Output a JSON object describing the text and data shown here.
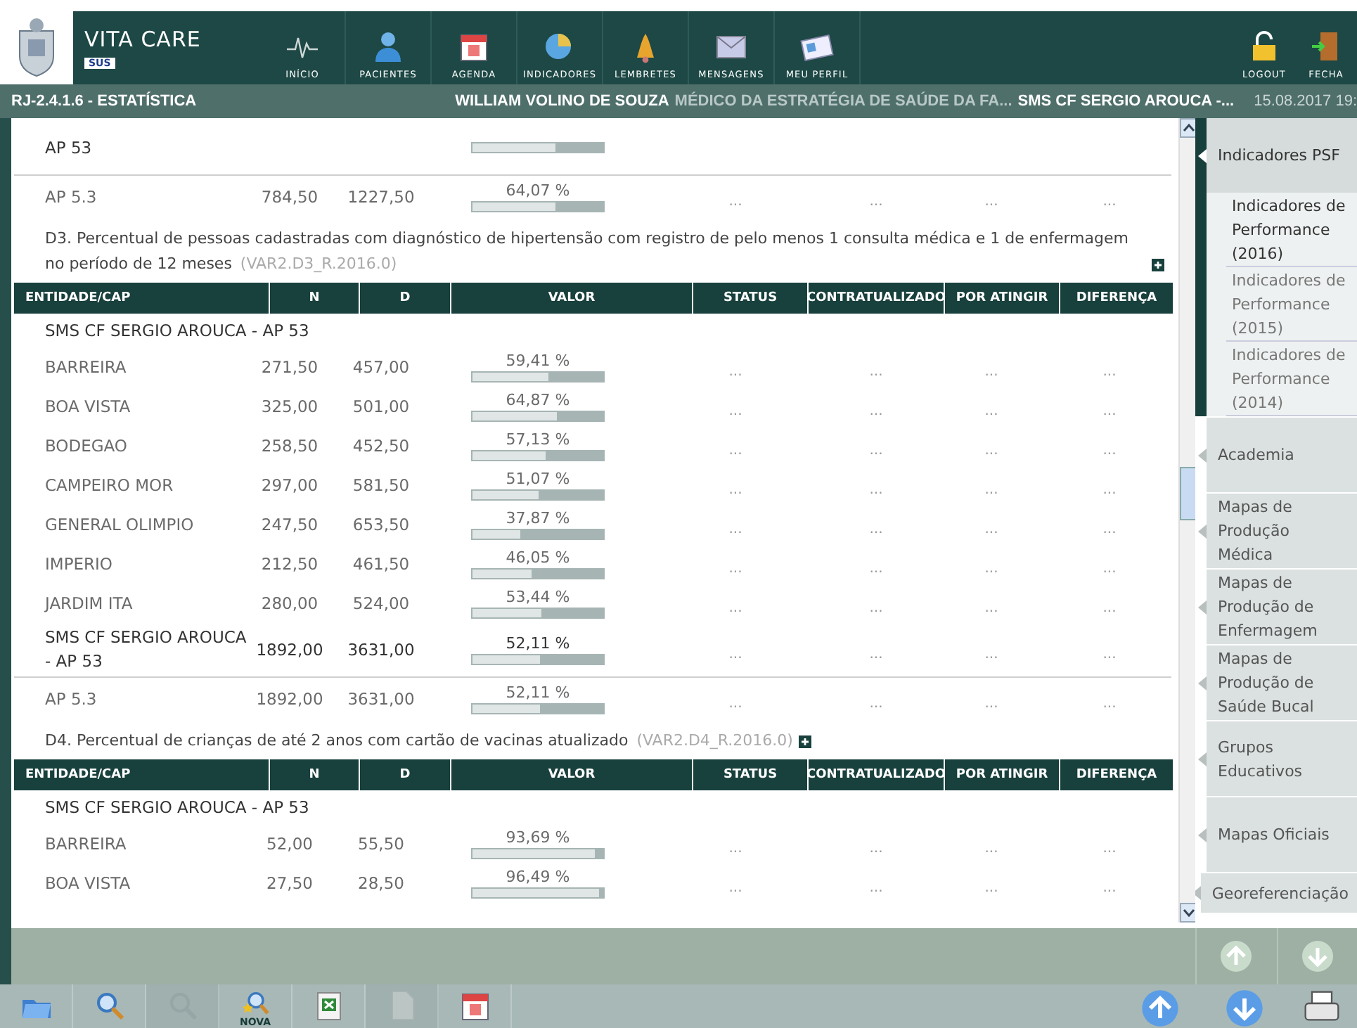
{
  "header": {
    "brand": "VITA CARE",
    "sub": "SUS",
    "nav": [
      {
        "kind": "pulse",
        "label": "INÍCIO"
      },
      {
        "kind": "person",
        "label": "PACIENTES"
      },
      {
        "kind": "calendar",
        "label": "AGENDA"
      },
      {
        "kind": "chart",
        "label": "INDICADORES"
      },
      {
        "kind": "bell",
        "label": "LEMBRETES"
      },
      {
        "kind": "mail",
        "label": "MENSAGENS"
      },
      {
        "kind": "card",
        "label": "MEU PERFIL"
      }
    ],
    "actions": [
      {
        "kind": "lock",
        "label": "LOGOUT"
      },
      {
        "kind": "door",
        "label": "FECHA"
      }
    ]
  },
  "info_bar": {
    "module": "RJ-2.4.1.6 - ESTATÍSTICA",
    "user": "WILLIAM VOLINO DE SOUZA",
    "role": "MÉDICO DA ESTRATÉGIA DE SAÚDE DA FA...",
    "unit": "SMS CF SERGIO AROUCA -...",
    "date": "15.08.2017 19:"
  },
  "sections": [
    {
      "rows": [
        {
          "kind": "total",
          "name": "AP 53",
          "level": 0.64
        },
        {
          "kind": "area",
          "name": "AP 5.3",
          "n": "784,50",
          "d": "1227,50",
          "value": "64,07 %",
          "level": 0.64,
          "status": "...",
          "contract": "...",
          "remaining": "...",
          "difference": "..."
        }
      ]
    },
    {
      "title": "D3. Percentual de pessoas cadastradas com diagnóstico de hipertensão com registro de pelo menos 1 consulta médica e 1 de enfermagem no período de 12 meses",
      "code": "(VAR2.D3_R.2016.0)",
      "columns": [
        "ENTIDADE/CAP",
        "N",
        "D",
        "VALOR",
        "STATUS",
        "CONTRATUALIZADO",
        "POR ATINGIR",
        "DIFERENÇA"
      ],
      "rows": [
        {
          "kind": "group",
          "name": "SMS CF SERGIO AROUCA - AP 53"
        },
        {
          "kind": "unit",
          "name": "BARREIRA",
          "n": "271,50",
          "d": "457,00",
          "value": "59,41 %",
          "level": 0.5941,
          "status": "...",
          "contract": "...",
          "remaining": "...",
          "difference": "..."
        },
        {
          "kind": "unit",
          "name": "BOA VISTA",
          "n": "325,00",
          "d": "501,00",
          "value": "64,87 %",
          "level": 0.6487,
          "status": "...",
          "contract": "...",
          "remaining": "...",
          "difference": "..."
        },
        {
          "kind": "unit",
          "name": "BODEGAO",
          "n": "258,50",
          "d": "452,50",
          "value": "57,13 %",
          "level": 0.5713,
          "status": "...",
          "contract": "...",
          "remaining": "...",
          "difference": "..."
        },
        {
          "kind": "unit",
          "name": "CAMPEIRO MOR",
          "n": "297,00",
          "d": "581,50",
          "value": "51,07 %",
          "level": 0.5107,
          "status": "...",
          "contract": "...",
          "remaining": "...",
          "difference": "..."
        },
        {
          "kind": "unit",
          "name": "GENERAL OLIMPIO",
          "n": "247,50",
          "d": "653,50",
          "value": "37,87 %",
          "level": 0.3787,
          "status": "...",
          "contract": "...",
          "remaining": "...",
          "difference": "..."
        },
        {
          "kind": "unit",
          "name": "IMPERIO",
          "n": "212,50",
          "d": "461,50",
          "value": "46,05 %",
          "level": 0.4605,
          "status": "...",
          "contract": "...",
          "remaining": "...",
          "difference": "..."
        },
        {
          "kind": "unit",
          "name": "JARDIM ITA",
          "n": "280,00",
          "d": "524,00",
          "value": "53,44 %",
          "level": 0.5344,
          "status": "...",
          "contract": "...",
          "remaining": "...",
          "difference": "..."
        },
        {
          "kind": "total",
          "name": "SMS CF SERGIO AROUCA - AP 53",
          "n": "1892,00",
          "d": "3631,00",
          "value": "52,11 %",
          "level": 0.5211,
          "status": "...",
          "contract": "...",
          "remaining": "...",
          "difference": "..."
        },
        {
          "kind": "area",
          "name": "AP 5.3",
          "n": "1892,00",
          "d": "3631,00",
          "value": "52,11 %",
          "level": 0.5211,
          "status": "...",
          "contract": "...",
          "remaining": "...",
          "difference": "..."
        }
      ]
    },
    {
      "title": "D4. Percentual de crianças de até 2 anos com cartão de vacinas atualizado",
      "code": "(VAR2.D4_R.2016.0)",
      "columns": [
        "ENTIDADE/CAP",
        "N",
        "D",
        "VALOR",
        "STATUS",
        "CONTRATUALIZADO",
        "POR ATINGIR",
        "DIFERENÇA"
      ],
      "rows": [
        {
          "kind": "group",
          "name": "SMS CF SERGIO AROUCA - AP 53"
        },
        {
          "kind": "unit",
          "name": "BARREIRA",
          "n": "52,00",
          "d": "55,50",
          "value": "93,69 %",
          "level": 0.9369,
          "status": "...",
          "contract": "...",
          "remaining": "...",
          "difference": "..."
        },
        {
          "kind": "unit",
          "name": "BOA VISTA",
          "n": "27,50",
          "d": "28,50",
          "value": "96,49 %",
          "level": 0.9649,
          "status": "...",
          "contract": "...",
          "remaining": "...",
          "difference": "..."
        }
      ]
    }
  ],
  "sidebar": {
    "items": [
      {
        "label": "Indicadores PSF",
        "expanded": true,
        "children": [
          {
            "label": "Indicadores de Performance (2016)",
            "selected": true
          },
          {
            "label": "Indicadores de Performance (2015)",
            "selected": false
          },
          {
            "label": "Indicadores de Performance (2014)",
            "selected": false
          }
        ]
      },
      {
        "label": "Academia",
        "expanded": false
      },
      {
        "label": "Mapas de Produção Médica",
        "expanded": false
      },
      {
        "label": "Mapas de Produção de Enfermagem",
        "expanded": false
      },
      {
        "label": "Mapas de Produção de Saúde Bucal",
        "expanded": false
      },
      {
        "label": "Grupos Educativos",
        "expanded": false
      },
      {
        "label": "Mapas Oficiais",
        "expanded": false
      },
      {
        "label": "Georeferenciação",
        "expanded": false
      }
    ]
  },
  "toolbar": {
    "items": [
      {
        "kind": "folder",
        "disabled": false
      },
      {
        "kind": "search-up",
        "disabled": false
      },
      {
        "kind": "search",
        "disabled": true
      },
      {
        "kind": "search-star",
        "label": "NOVA",
        "disabled": false
      },
      {
        "kind": "sheet",
        "disabled": false
      },
      {
        "kind": "doc",
        "disabled": true
      },
      {
        "kind": "calendar",
        "disabled": false
      }
    ]
  }
}
